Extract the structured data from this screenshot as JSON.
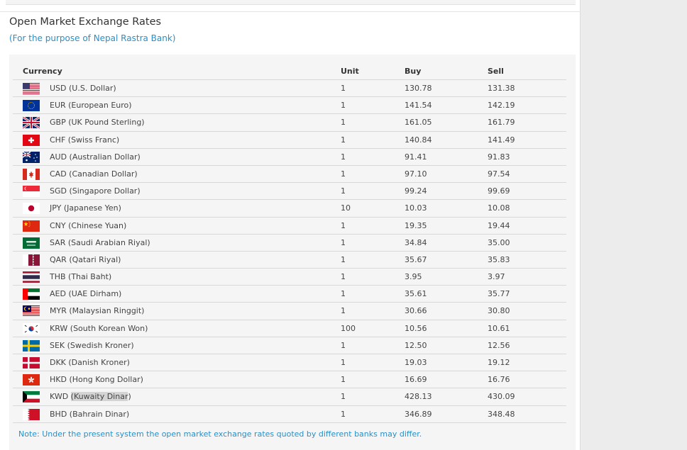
{
  "page": {
    "title": "Open Market Exchange Rates",
    "subtitle": "(For the purpose of Nepal Rastra Bank)",
    "note": "Note: Under the present system the open market exchange rates quoted by different banks may differ."
  },
  "table": {
    "headers": {
      "currency": "Currency",
      "unit": "Unit",
      "buy": "Buy",
      "sell": "Sell"
    },
    "rows": [
      {
        "flag": "us-flag-icon",
        "name": "USD (U.S. Dollar)",
        "unit": "1",
        "buy": "130.78",
        "sell": "131.38"
      },
      {
        "flag": "eu-flag-icon",
        "name": "EUR (European Euro)",
        "unit": "1",
        "buy": "141.54",
        "sell": "142.19"
      },
      {
        "flag": "gb-flag-icon",
        "name": "GBP (UK Pound Sterling)",
        "unit": "1",
        "buy": "161.05",
        "sell": "161.79"
      },
      {
        "flag": "ch-flag-icon",
        "name": "CHF (Swiss Franc)",
        "unit": "1",
        "buy": "140.84",
        "sell": "141.49"
      },
      {
        "flag": "au-flag-icon",
        "name": "AUD (Australian Dollar)",
        "unit": "1",
        "buy": "91.41",
        "sell": "91.83"
      },
      {
        "flag": "ca-flag-icon",
        "name": "CAD (Canadian Dollar)",
        "unit": "1",
        "buy": "97.10",
        "sell": "97.54"
      },
      {
        "flag": "sg-flag-icon",
        "name": "SGD (Singapore Dollar)",
        "unit": "1",
        "buy": "99.24",
        "sell": "99.69"
      },
      {
        "flag": "jp-flag-icon",
        "name": "JPY (Japanese Yen)",
        "unit": "10",
        "buy": "10.03",
        "sell": "10.08"
      },
      {
        "flag": "cn-flag-icon",
        "name": "CNY (Chinese Yuan)",
        "unit": "1",
        "buy": "19.35",
        "sell": "19.44"
      },
      {
        "flag": "sa-flag-icon",
        "name": "SAR (Saudi Arabian Riyal)",
        "unit": "1",
        "buy": "34.84",
        "sell": "35.00"
      },
      {
        "flag": "qa-flag-icon",
        "name": "QAR (Qatari Riyal)",
        "unit": "1",
        "buy": "35.67",
        "sell": "35.83"
      },
      {
        "flag": "th-flag-icon",
        "name": "THB (Thai Baht)",
        "unit": "1",
        "buy": "3.95",
        "sell": "3.97"
      },
      {
        "flag": "ae-flag-icon",
        "name": "AED (UAE Dirham)",
        "unit": "1",
        "buy": "35.61",
        "sell": "35.77"
      },
      {
        "flag": "my-flag-icon",
        "name": "MYR (Malaysian Ringgit)",
        "unit": "1",
        "buy": "30.66",
        "sell": "30.80"
      },
      {
        "flag": "kr-flag-icon",
        "name": "KRW (South Korean Won)",
        "unit": "100",
        "buy": "10.56",
        "sell": "10.61"
      },
      {
        "flag": "se-flag-icon",
        "name": "SEK (Swedish Kroner)",
        "unit": "1",
        "buy": "12.50",
        "sell": "12.56"
      },
      {
        "flag": "dk-flag-icon",
        "name": "DKK (Danish Kroner)",
        "unit": "1",
        "buy": "19.03",
        "sell": "19.12"
      },
      {
        "flag": "hk-flag-icon",
        "name": "HKD (Hong Kong Dollar)",
        "unit": "1",
        "buy": "16.69",
        "sell": "16.76"
      },
      {
        "flag": "kw-flag-icon",
        "name": "KWD",
        "name_highlighted": "(Kuwaity Dinar",
        "name_tail": ")",
        "unit": "1",
        "buy": "428.13",
        "sell": "430.09"
      },
      {
        "flag": "bh-flag-icon",
        "name": "BHD (Bahrain Dinar)",
        "unit": "1",
        "buy": "346.89",
        "sell": "348.48"
      }
    ]
  },
  "colors": {
    "accent_link": "#2a8fc6",
    "table_background": "#f5f5f5",
    "selection_highlight": "#d4d4d4"
  }
}
